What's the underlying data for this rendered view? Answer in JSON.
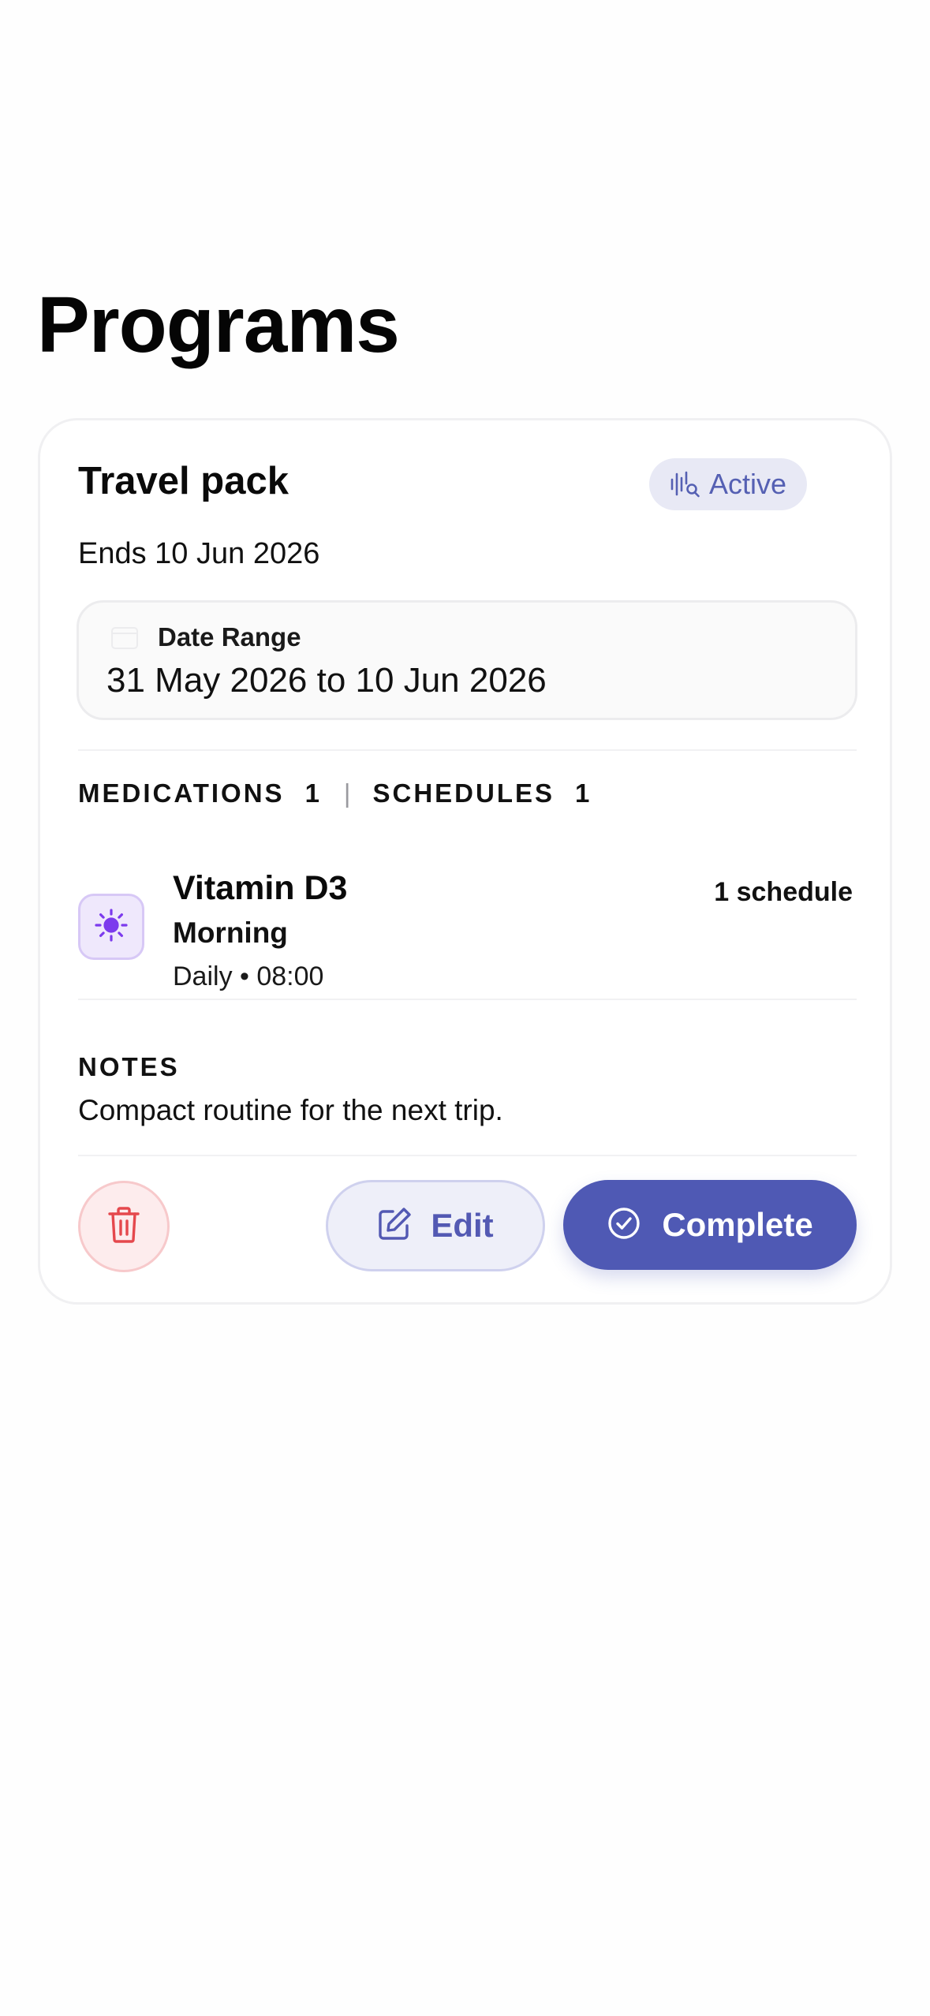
{
  "page": {
    "title": "Programs"
  },
  "program": {
    "name": "Travel pack",
    "status": "Active",
    "ends_text": "Ends 10 Jun 2026",
    "date_range": {
      "label": "Date Range",
      "value": "31 May 2026 to 10 Jun 2026"
    },
    "counts": {
      "medications_label": "MEDICATIONS",
      "medications_count": "1",
      "separator": "|",
      "schedules_label": "SCHEDULES",
      "schedules_count": "1"
    },
    "medications": [
      {
        "name": "Vitamin D3",
        "time_label": "Morning",
        "detail": "Daily • 08:00",
        "schedule_count": "1 schedule",
        "icon": "sun-icon"
      }
    ],
    "notes": {
      "heading": "NOTES",
      "text": "Compact routine for the next trip."
    },
    "actions": {
      "delete_icon": "trash-icon",
      "edit_label": "Edit",
      "edit_icon": "edit-icon",
      "complete_label": "Complete",
      "complete_icon": "check-circle-icon"
    }
  },
  "colors": {
    "accent": "#4f59b4",
    "badge_background": "#e8e9f5",
    "badge_text": "#5560b3",
    "medication_icon": "#7c3aed",
    "delete_red": "#e5484d",
    "delete_background": "#fdeced"
  }
}
